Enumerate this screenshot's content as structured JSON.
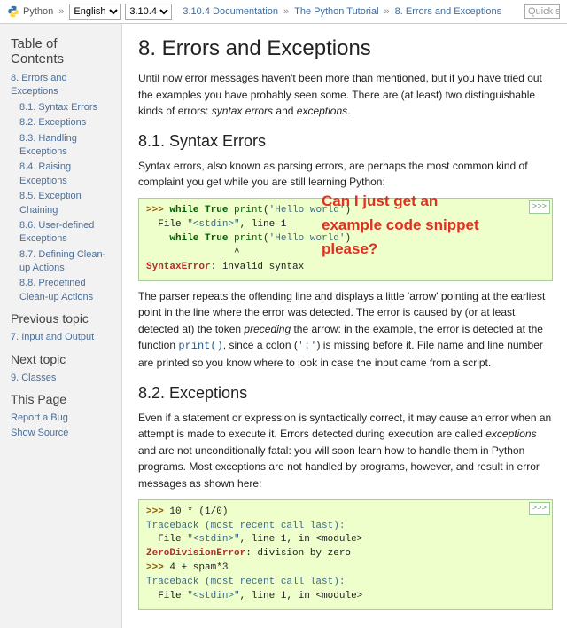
{
  "topbar": {
    "brand": "Python",
    "lang_selected": "English",
    "version_selected": "3.10.4",
    "crumbs": [
      "3.10.4 Documentation",
      "The Python Tutorial",
      "8. Errors and Exceptions"
    ],
    "quick_placeholder": "Quick s"
  },
  "sidebar": {
    "toc_heading": "Table of Contents",
    "toc": [
      {
        "label": "8. Errors and Exceptions",
        "sub": false
      },
      {
        "label": "8.1. Syntax Errors",
        "sub": true
      },
      {
        "label": "8.2. Exceptions",
        "sub": true
      },
      {
        "label": "8.3. Handling Exceptions",
        "sub": true
      },
      {
        "label": "8.4. Raising Exceptions",
        "sub": true
      },
      {
        "label": "8.5. Exception Chaining",
        "sub": true
      },
      {
        "label": "8.6. User-defined Exceptions",
        "sub": true
      },
      {
        "label": "8.7. Defining Clean-up Actions",
        "sub": true
      },
      {
        "label": "8.8. Predefined Clean-up Actions",
        "sub": true
      }
    ],
    "prev_heading": "Previous topic",
    "prev_link": "7. Input and Output",
    "next_heading": "Next topic",
    "next_link": "9. Classes",
    "thispage_heading": "This Page",
    "thispage_links": [
      "Report a Bug",
      "Show Source"
    ]
  },
  "content": {
    "h1": "8. Errors and Exceptions",
    "intro_a": "Until now error messages haven't been more than mentioned, but if you have tried out the examples you have probably seen some. There are (at least) two distinguishable kinds of errors: ",
    "intro_em1": "syntax errors",
    "intro_mid": " and ",
    "intro_em2": "exceptions",
    "intro_end": ".",
    "h2_1": "8.1. Syntax Errors",
    "p1": "Syntax errors, also known as parsing errors, are perhaps the most common kind of complaint you get while you are still learning Python:",
    "code1": {
      "copy": ">>>",
      "l1a": ">>> ",
      "l1b": "while True ",
      "l1c": "print",
      "l1d": "(",
      "l1e": "'Hello world'",
      "l1f": ")",
      "l2": "  File ",
      "l2b": "\"<stdin>\"",
      "l2c": ", line ",
      "l2d": "1",
      "l3a": "    ",
      "l3b": "while True ",
      "l3c": "print",
      "l3d": "(",
      "l3e": "'Hello world'",
      "l3f": ")",
      "l4": "               ^",
      "l5a": "SyntaxError",
      "l5b": ": invalid syntax"
    },
    "p2a": "The parser repeats the offending line and displays a little 'arrow' pointing at the earliest point in the line where the error was detected. The error is caused by (or at least detected at) the token ",
    "p2em": "preceding",
    "p2b": " the arrow: in the example, the error is detected at the function ",
    "p2code1": "print()",
    "p2c": ", since a colon (",
    "p2code2": "':'",
    "p2d": ") is missing before it. File name and line number are printed so you know where to look in case the input came from a script.",
    "h2_2": "8.2. Exceptions",
    "p3a": "Even if a statement or expression is syntactically correct, it may cause an error when an attempt is made to execute it. Errors detected during execution are called ",
    "p3em": "exceptions",
    "p3b": " and are not unconditionally fatal: you will soon learn how to handle them in Python programs. Most exceptions are not handled by programs, however, and result in error messages as shown here:",
    "code2": {
      "copy": ">>>",
      "l1a": ">>> ",
      "l1b": "10 * (1/0)",
      "l2": "Traceback (most recent call last):",
      "l3a": "  File ",
      "l3b": "\"<stdin>\"",
      "l3c": ", line ",
      "l3d": "1",
      "l3e": ", in <module>",
      "l4a": "ZeroDivisionError",
      "l4b": ": division by zero",
      "l5a": ">>> ",
      "l5b": "4 + spam*3",
      "l6": "Traceback (most recent call last):",
      "l7a": "  File ",
      "l7b": "\"<stdin>\"",
      "l7c": ", line ",
      "l7d": "1",
      "l7e": ", in <module>"
    }
  },
  "annotation": {
    "line1": "Can I just get an",
    "line2": "example code snippet",
    "line3": "please?"
  }
}
